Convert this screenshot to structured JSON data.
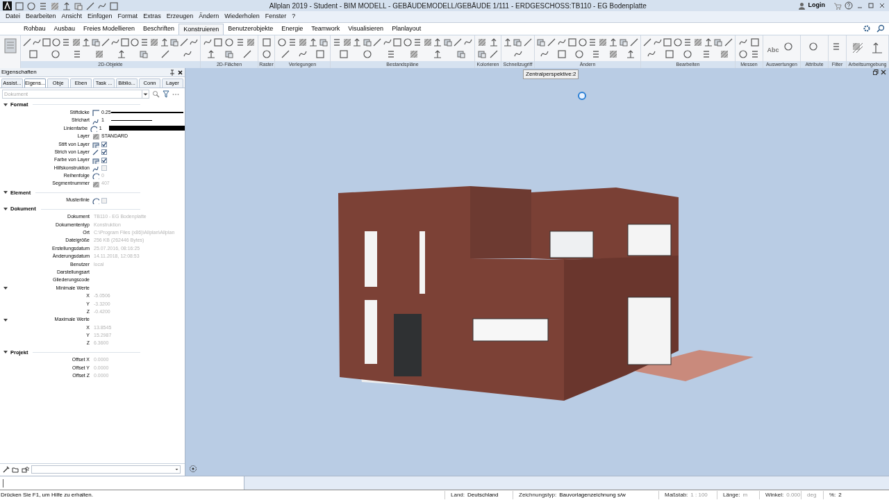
{
  "window": {
    "title": "Allplan 2019 - Student - BIM MODELL - GEBÄUDEMODELL/GEBÄUDE 1/111 - ERDGESCHOSS:TB110 - EG Bodenplatte",
    "login": "Login"
  },
  "menu": [
    "Datei",
    "Bearbeiten",
    "Ansicht",
    "Einfügen",
    "Format",
    "Extras",
    "Erzeugen",
    "Ändern",
    "Wiederholen",
    "Fenster",
    "?"
  ],
  "ribbon": {
    "tabs": [
      {
        "label": "Rohbau",
        "selected": false
      },
      {
        "label": "Ausbau",
        "selected": false
      },
      {
        "label": "Freies Modellieren",
        "selected": false
      },
      {
        "label": "Beschriften",
        "selected": false
      },
      {
        "label": "Konstruieren",
        "selected": true
      },
      {
        "label": "Benutzerobjekte",
        "selected": false
      },
      {
        "label": "Energie",
        "selected": false
      },
      {
        "label": "Teamwork",
        "selected": false
      },
      {
        "label": "Visualisieren",
        "selected": false
      },
      {
        "label": "Planlayout",
        "selected": false
      }
    ],
    "groups": [
      "2D-Objekte",
      "2D-Flächen",
      "Raster",
      "Verlegungen",
      "Bestandspläne",
      "Kolorieren",
      "Schnellzugriff",
      "Ändern",
      "Bearbeiten",
      "Messen",
      "Auswertungen",
      "Attribute",
      "Filter",
      "Arbeitsumgebung"
    ],
    "label_abc": "Abc"
  },
  "properties": {
    "title": "Eigenschaften",
    "tabs": [
      {
        "label": "Assist...",
        "selected": false
      },
      {
        "label": "Eigens...",
        "selected": true
      },
      {
        "label": "Obje",
        "selected": false
      },
      {
        "label": "Eben",
        "selected": false
      },
      {
        "label": "Task ...",
        "selected": false
      },
      {
        "label": "Biblio...",
        "selected": false
      },
      {
        "label": "Conn",
        "selected": false
      },
      {
        "label": "Layer",
        "selected": false
      }
    ],
    "filter": {
      "placeholder": "Dokument"
    },
    "sections": [
      {
        "title": "Format",
        "expanded": true,
        "icons": true,
        "rows": [
          {
            "kind": "pen",
            "label": "Stiftdicke",
            "value": "0.25",
            "disabled": false
          },
          {
            "kind": "linetype",
            "label": "Strichart",
            "value": "1",
            "disabled": false
          },
          {
            "kind": "color",
            "label": "Linienfarbe",
            "value": "1",
            "color": "#000000",
            "disabled": false
          },
          {
            "kind": "text",
            "label": "Layer",
            "value": "STANDARD",
            "disabled": false
          },
          {
            "kind": "check",
            "label": "Stift von Layer",
            "checked": true
          },
          {
            "kind": "check",
            "label": "Strich von Layer",
            "checked": true
          },
          {
            "kind": "check",
            "label": "Farbe von Layer",
            "checked": true
          },
          {
            "kind": "check",
            "label": "Hilfskonstruktion",
            "checked": false
          },
          {
            "kind": "text",
            "label": "Reihenfolge",
            "value": "0",
            "disabled": true
          },
          {
            "kind": "text",
            "label": "Segmentnummer",
            "value": "407",
            "disabled": true
          }
        ]
      },
      {
        "title": "Element",
        "expanded": true,
        "icons": true,
        "rows": [
          {
            "kind": "check",
            "label": "Musterlinie",
            "checked": false
          }
        ]
      },
      {
        "title": "Dokument",
        "expanded": true,
        "icons": false,
        "rows": [
          {
            "kind": "text",
            "label": "Dokument",
            "value": "TB110 - EG Bodenplatte",
            "disabled": true
          },
          {
            "kind": "text",
            "label": "Dokumententyp",
            "value": "Konstruktion",
            "disabled": true
          },
          {
            "kind": "text",
            "label": "Ort",
            "value": "C:\\Program Files (x86)\\Allplan\\Allplan",
            "disabled": true
          },
          {
            "kind": "text",
            "label": "Dateigröße",
            "value": "256 KB (262446 Bytes)",
            "disabled": true
          },
          {
            "kind": "text",
            "label": "Erstellungsdatum",
            "value": "25.07.2016, 08:16:25",
            "disabled": true
          },
          {
            "kind": "text",
            "label": "Änderungsdatum",
            "value": "14.11.2018, 12:08:53",
            "disabled": true
          },
          {
            "kind": "text",
            "label": "Benutzer",
            "value": "local",
            "disabled": true
          },
          {
            "kind": "text",
            "label": "Darstellungsart"
          },
          {
            "kind": "text",
            "label": "Gliederungscode"
          },
          {
            "kind": "group",
            "label": "Minimale Werte",
            "expanded": true,
            "children": [
              {
                "kind": "text",
                "label": "X",
                "value": "-5.0506",
                "disabled": true
              },
              {
                "kind": "text",
                "label": "Y",
                "value": "-3.3200",
                "disabled": true
              },
              {
                "kind": "text",
                "label": "Z",
                "value": "-0.4200",
                "disabled": true
              }
            ]
          },
          {
            "kind": "group",
            "label": "Maximale Werte",
            "expanded": true,
            "children": [
              {
                "kind": "text",
                "label": "X",
                "value": "13.8545",
                "disabled": true
              },
              {
                "kind": "text",
                "label": "Y",
                "value": "15.2987",
                "disabled": true
              },
              {
                "kind": "text",
                "label": "Z",
                "value": "6.3600",
                "disabled": true
              }
            ]
          }
        ]
      },
      {
        "title": "Projekt",
        "expanded": true,
        "icons": false,
        "rows": [
          {
            "kind": "text",
            "label": "Offset X",
            "value": "0.0000",
            "disabled": true
          },
          {
            "kind": "text",
            "label": "Offset Y",
            "value": "0.0000",
            "disabled": true
          },
          {
            "kind": "text",
            "label": "Offset Z",
            "value": "0.0000",
            "disabled": true
          }
        ]
      }
    ]
  },
  "viewport": {
    "title": "Zentralperspektive:2"
  },
  "status_bar": {
    "help": "Drücken Sie F1, um Hilfe zu erhalten.",
    "fields": [
      {
        "label": "Land:",
        "value": "Deutschland",
        "disabled": false
      },
      {
        "label": "Zeichnungstyp:",
        "value": "Bauvorlagenzeichnung s/w",
        "disabled": false
      },
      {
        "label": "Maßstab:",
        "value": "1 : 100",
        "disabled": true
      },
      {
        "label": "Länge:",
        "value": "m",
        "disabled": true
      },
      {
        "label": "Winkel:",
        "value": "0.000",
        "disabled": true
      },
      {
        "value": "deg",
        "disabled": true
      },
      {
        "label": "%:",
        "value": "2",
        "disabled": false
      }
    ]
  }
}
